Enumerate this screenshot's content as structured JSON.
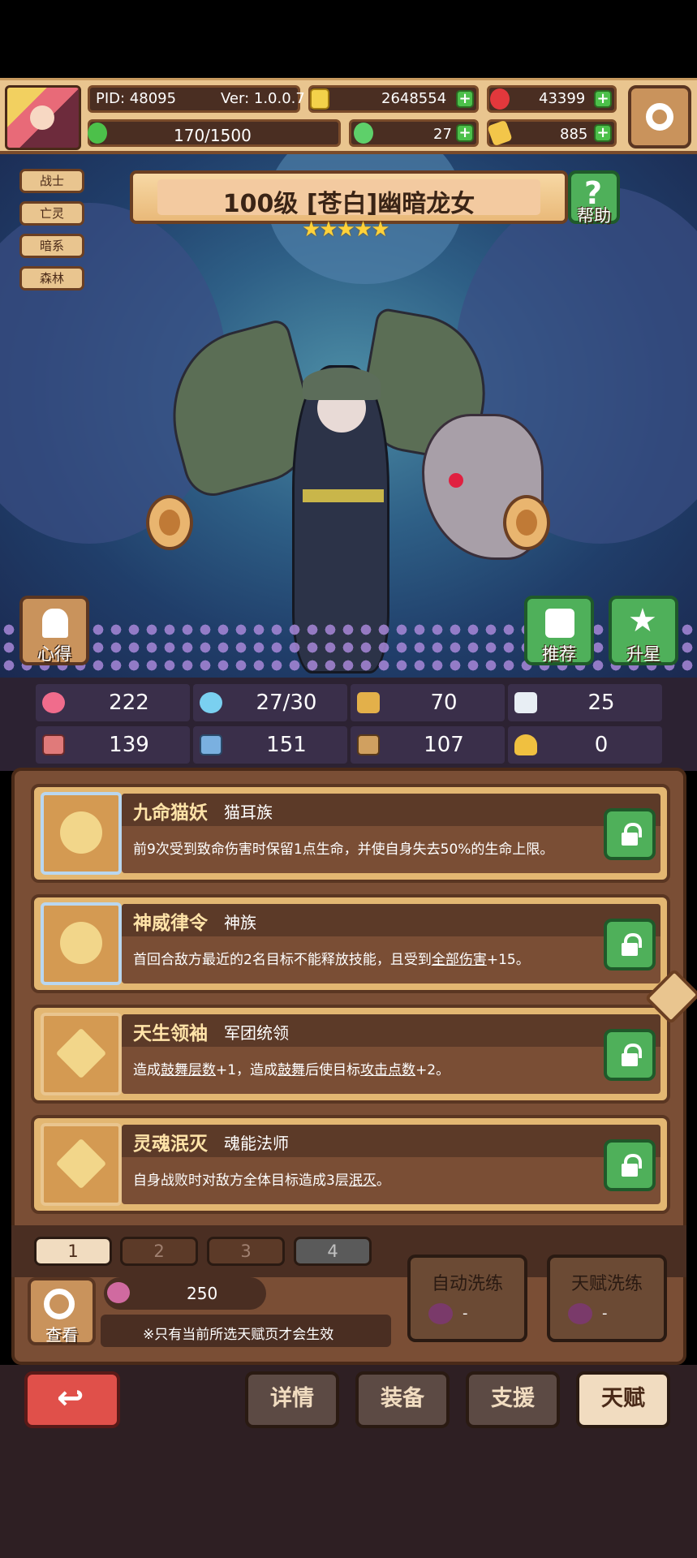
{
  "header": {
    "pid": "PID: 48095",
    "version": "Ver: 1.0.0.7",
    "gold": "2648554",
    "gems": "43399",
    "energy": "170/1500",
    "clover": "27",
    "tickets": "885"
  },
  "hero": {
    "tags": [
      "战士",
      "亡灵",
      "暗系",
      "森林"
    ],
    "title": "100级  [苍白]幽暗龙女",
    "stars": "★★★★★",
    "help_label": "帮助",
    "insight_label": "心得",
    "recommend_label": "推荐",
    "star_up_label": "升星"
  },
  "stats": {
    "hp": "222",
    "mana": "27/30",
    "defense": "70",
    "speed": "25",
    "attack": "139",
    "magic": "151",
    "resist": "107",
    "crit": "0"
  },
  "talents": [
    {
      "name": "九命猫妖",
      "sub": "猫耳族",
      "desc": "前9次受到致命伤害时保留1点生命，并使自身失去50%的生命上限。"
    },
    {
      "name": "神威律令",
      "sub": "神族",
      "desc_a": "首回合敌方最近的2名目标不能释放技能，且受到",
      "desc_u": "全部伤害",
      "desc_b": "+15。"
    },
    {
      "name": "天生领袖",
      "sub": "军团统领",
      "desc_a": "造成",
      "desc_u1": "鼓舞层数",
      "desc_b": "+1，造成",
      "desc_u2": "鼓舞",
      "desc_c": "后使目标",
      "desc_u3": "攻击点数",
      "desc_d": "+2。"
    },
    {
      "name": "灵魂泯灭",
      "sub": "魂能法师",
      "desc_a": "自身战败时对敌方全体目标造成3层",
      "desc_u": "泯灭",
      "desc_b": "。"
    }
  ],
  "pages": [
    "1",
    "2",
    "3",
    "4"
  ],
  "bottom_panel": {
    "cost": "250",
    "note": "※只有当前所选天赋页才会生效",
    "view_label": "查看",
    "auto_wash_label": "自动洗练",
    "auto_wash_value": "-",
    "talent_wash_label": "天赋洗练",
    "talent_wash_value": "-"
  },
  "nav": {
    "details": "详情",
    "equipment": "装备",
    "support": "支援",
    "talent": "天赋"
  },
  "colors": {
    "panel_bg": "#7a4e35",
    "accent_gold": "#e3b772",
    "lock_green": "#4fb05a",
    "back_red": "#e0504a"
  }
}
